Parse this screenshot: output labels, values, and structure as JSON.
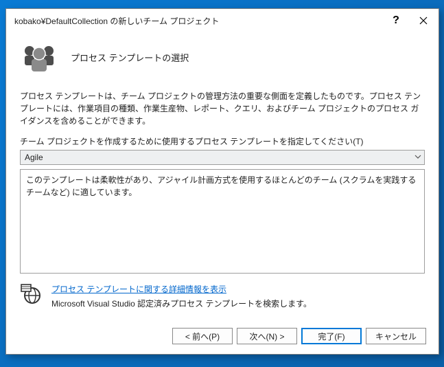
{
  "titlebar": {
    "title": "kobako¥DefaultCollection の新しいチーム プロジェクト"
  },
  "header": {
    "title": "プロセス テンプレートの選択"
  },
  "intro": "プロセス テンプレートは、チーム プロジェクトの管理方法の重要な側面を定義したものです。プロセス テンプレートには、作業項目の種類、作業生産物、レポート、クエリ、およびチーム プロジェクトのプロセス ガイダンスを含めることができます。",
  "field_label": "チーム プロジェクトを作成するために使用するプロセス テンプレートを指定してください(T)",
  "template": {
    "selected": "Agile",
    "description": "このテンプレートは柔軟性があり、アジャイル計画方式を使用するほとんどのチーム (スクラムを実践するチームなど) に適しています。"
  },
  "info": {
    "link_text": "プロセス テンプレートに関する詳細情報を表示",
    "sub_text": "Microsoft Visual Studio 認定済みプロセス テンプレートを検索します。"
  },
  "buttons": {
    "previous": "< 前へ(P)",
    "next": "次へ(N) >",
    "finish": "完了(F)",
    "cancel": "キャンセル"
  }
}
